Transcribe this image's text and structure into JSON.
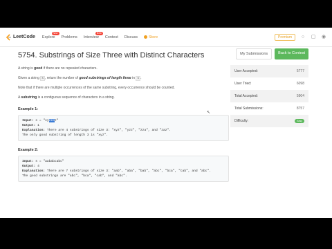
{
  "nav": {
    "logo_text": "LeetCode",
    "items": [
      {
        "label": "Explore",
        "badge": "New"
      },
      {
        "label": "Problems",
        "badge": ""
      },
      {
        "label": "Interview",
        "badge": "New"
      },
      {
        "label": "Contest",
        "badge": ""
      },
      {
        "label": "Discuss",
        "badge": ""
      }
    ],
    "store_label": "Store",
    "premium_label": "Premium",
    "accent_color": "#f0a020"
  },
  "problem": {
    "title": "5754. Substrings of Size Three with Distinct Characters",
    "p1": {
      "pre": "A string is ",
      "bold": "good",
      "post": " if there are no repeated characters."
    },
    "p2": {
      "pre": "Given a string ",
      "code": "s",
      "mid": ", return the number of ",
      "bold": "good substrings of length three",
      "mid2": " in ",
      "code2": "s",
      "post": "."
    },
    "p3": "Note that if there are multiple occurrences of the same substring, every occurrence should be counted.",
    "p4": {
      "bold": "substring",
      "pre": "A ",
      "post": " is a contiguous sequence of characters in a string."
    },
    "example1": {
      "heading": "Example 1:",
      "input_label": "Input:",
      "input_pre": " s = \"xy",
      "input_sel": "zza",
      "input_post": "z\"",
      "output_label": "Output:",
      "output_value": " 1",
      "explanation_label": "Explanation:",
      "explanation_value": " There are 4 substrings of size 3: \"xyz\", \"yzz\", \"zza\", and \"zaz\".",
      "explanation_line2": "The only good substring of length 3 is \"xyz\"."
    },
    "example2": {
      "heading": "Example 2:",
      "input_label": "Input:",
      "input_value": " s = \"aababcabc\"",
      "output_label": "Output:",
      "output_value": " 4",
      "explanation_label": "Explanation:",
      "explanation_value": " There are 7 substrings of size 3: \"aab\", \"aba\", \"bab\", \"abc\", \"bca\", \"cab\", and \"abc\".",
      "explanation_line2": "The good substrings are \"abc\", \"bca\", \"cab\", and \"abc\"."
    }
  },
  "sidebar": {
    "my_submissions": "My Submissions",
    "back_to_contest": "Back to Contest",
    "stats": [
      {
        "label": "User Accepted:",
        "value": "5777"
      },
      {
        "label": "User Tried:",
        "value": "6098"
      },
      {
        "label": "Total Accepted:",
        "value": "5904"
      },
      {
        "label": "Total Submissions:",
        "value": "8757"
      },
      {
        "label": "Difficulty:",
        "value": "Easy"
      }
    ],
    "easy_color": "#5cb85c"
  }
}
